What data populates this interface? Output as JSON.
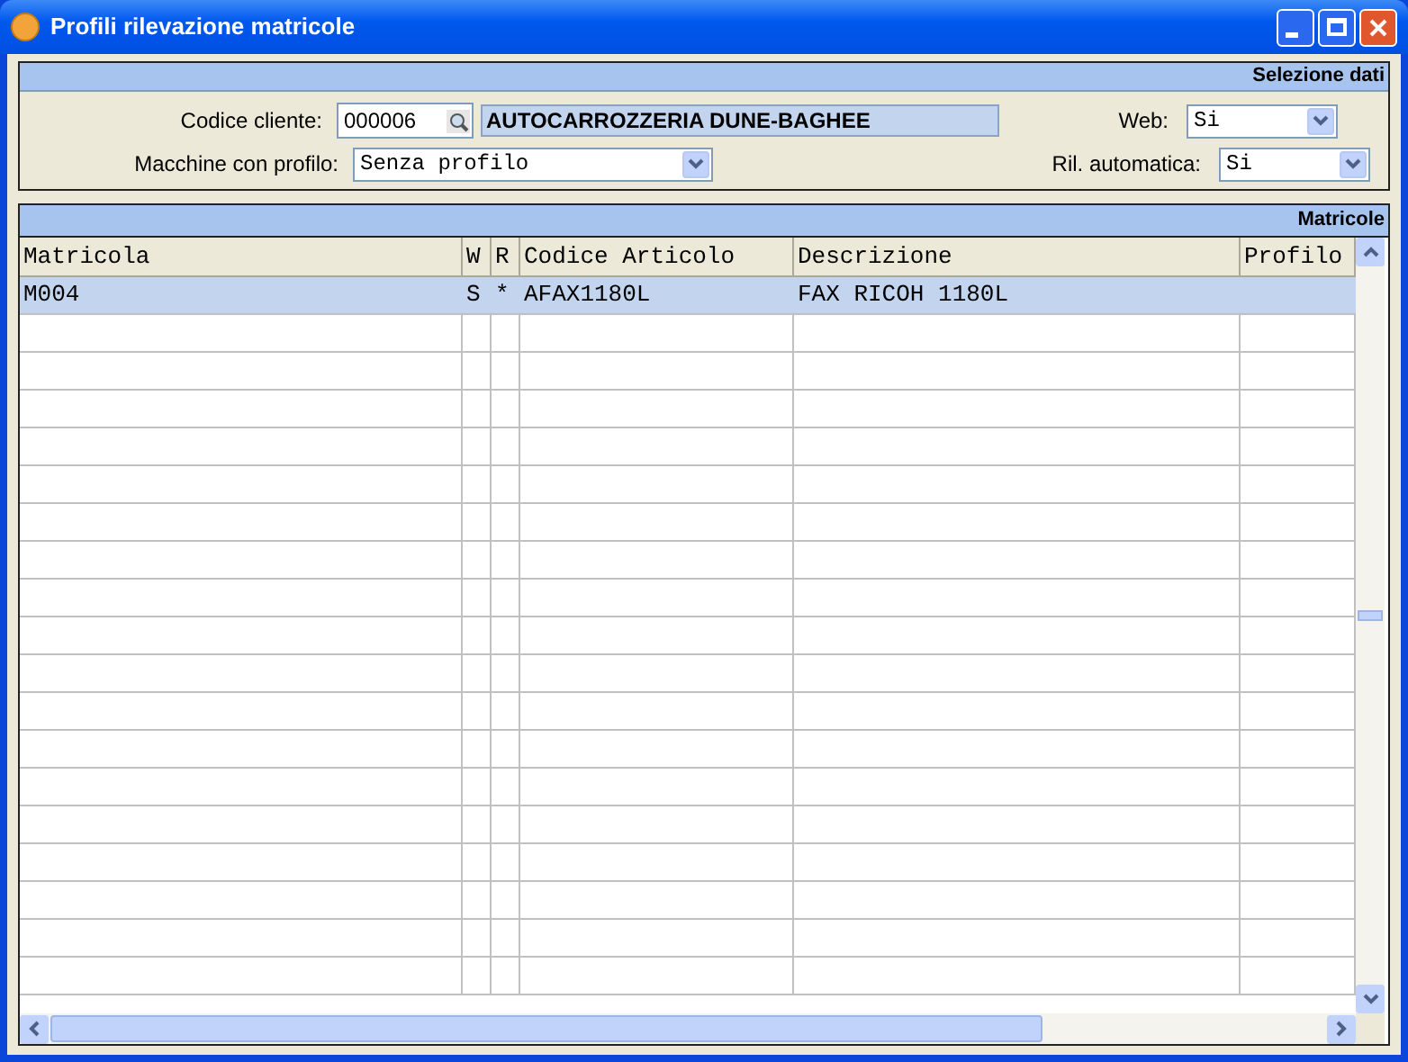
{
  "window": {
    "title": "Profili rilevazione matricole"
  },
  "selection_panel": {
    "title": "Selezione dati",
    "codice_cliente": {
      "label": "Codice cliente:",
      "value": "000006",
      "name": "AUTOCARROZZERIA DUNE-BAGHEE"
    },
    "macchine": {
      "label": "Macchine con profilo:",
      "value": "Senza profilo"
    },
    "web": {
      "label": "Web:",
      "value": "Si"
    },
    "ril_automatica": {
      "label": "Ril. automatica:",
      "value": "Si"
    }
  },
  "grid": {
    "title": "Matricole",
    "columns": [
      "Matricola",
      "W",
      "R",
      "Codice Articolo",
      "Descrizione",
      "Profilo"
    ],
    "rows": [
      {
        "selected": true,
        "cells": [
          "M004",
          "S",
          "*",
          "AFAX1180L",
          "FAX RICOH 1180L",
          ""
        ]
      }
    ]
  }
}
